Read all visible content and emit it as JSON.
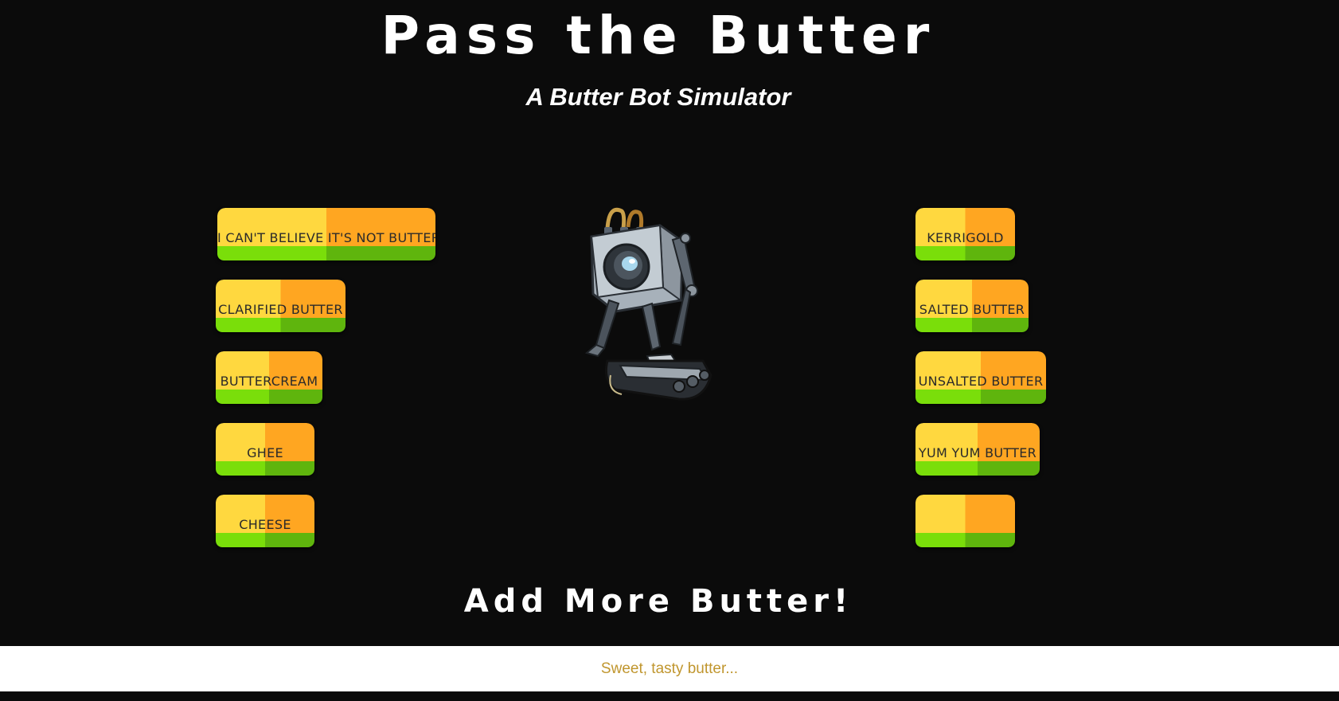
{
  "header": {
    "title": "Pass the Butter",
    "subtitle": "A Butter Bot Simulator"
  },
  "left_column": {
    "items": [
      {
        "label": "I CAN'T BELIEVE IT'S NOT BUTTER"
      },
      {
        "label": "CLARIFIED BUTTER"
      },
      {
        "label": "BUTTERCREAM"
      },
      {
        "label": "GHEE"
      },
      {
        "label": "CHEESE"
      }
    ]
  },
  "right_column": {
    "items": [
      {
        "label": "KERRIGOLD"
      },
      {
        "label": "SALTED BUTTER"
      },
      {
        "label": "UNSALTED BUTTER"
      },
      {
        "label": "YUM YUM BUTTER"
      },
      {
        "label": ""
      }
    ]
  },
  "add_section": {
    "heading": "Add More Butter!",
    "input_placeholder": "Sweet, tasty butter..."
  },
  "colors": {
    "background": "#0b0b0b",
    "butter_yellow": "#ffd83f",
    "butter_orange": "#ffa621",
    "base_green_light": "#7ade0a",
    "base_green_dark": "#5fb50d",
    "placeholder_text": "#c0962e"
  },
  "icons": {
    "mascot": "butter-robot-icon"
  }
}
